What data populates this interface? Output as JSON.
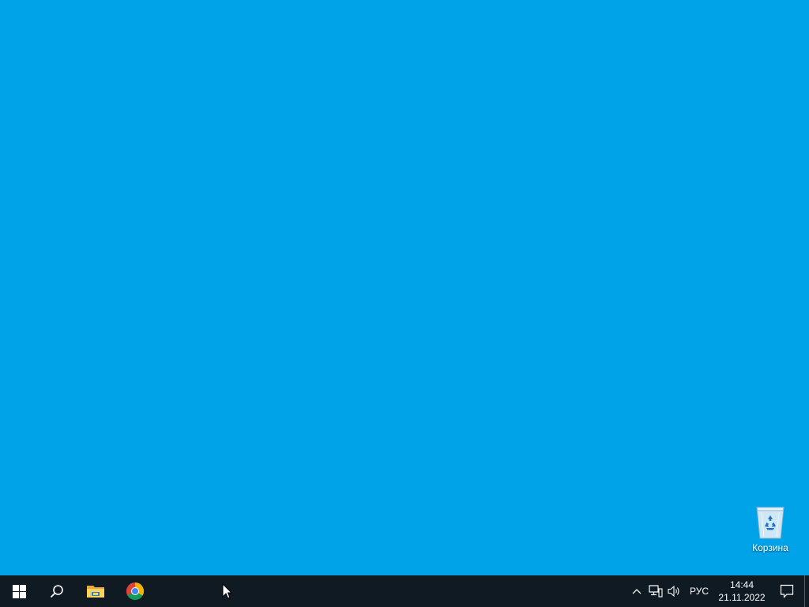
{
  "desktop": {
    "background_color": "#00a2e8",
    "icons": [
      {
        "label": "Корзина",
        "icon": "recycle-bin-icon"
      }
    ]
  },
  "taskbar": {
    "background_color": "#0f1a23",
    "start": {
      "icon": "windows-logo-icon"
    },
    "search": {
      "icon": "search-icon"
    },
    "pinned_apps": [
      {
        "icon": "file-explorer-icon"
      },
      {
        "icon": "chrome-icon"
      }
    ],
    "tray": {
      "overflow_icon": "chevron-up-icon",
      "network_icon": "network-icon",
      "volume_icon": "volume-icon",
      "language": "РУС",
      "time": "14:44",
      "date": "21.11.2022",
      "notifications_icon": "action-center-icon"
    }
  }
}
